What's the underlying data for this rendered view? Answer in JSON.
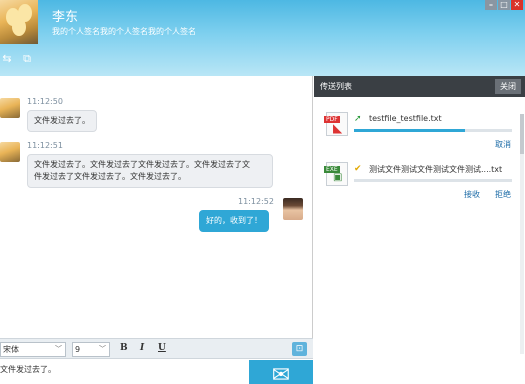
{
  "header": {
    "name": "李东",
    "signature": "我的个人签名我的个人签名我的个人签名",
    "window_buttons": {
      "minimize": "–",
      "maximize": "□",
      "close": "✕"
    },
    "tools": [
      {
        "icon": "transfer-file-icon",
        "glyph": "⇆"
      },
      {
        "icon": "remote-screen-icon",
        "glyph": "⧉"
      }
    ]
  },
  "chat": {
    "messages": [
      {
        "sender": "other",
        "time": "11:12:50",
        "text": "文件发过去了。"
      },
      {
        "sender": "other",
        "time": "11:12:51",
        "lines": [
          "文件发过去了。文件发过去了文件发过去了。文件发过去了文",
          "件发过去了文件发过去了。文件发过去了。"
        ]
      },
      {
        "sender": "self",
        "time": "11:12:52",
        "text": "好的，收到了！"
      }
    ]
  },
  "format_bar": {
    "font": "宋体",
    "size": "9",
    "bold": "B",
    "italic": "I",
    "underline": "U"
  },
  "input": {
    "value": "文件发过去了。"
  },
  "transfer_panel": {
    "title": "传送列表",
    "close_label": "关闭",
    "files": [
      {
        "name": "testfile_testfile.txt",
        "type": "PDF",
        "progress": 0.7,
        "actions": [
          "取消"
        ],
        "status_icon": "upload-arrow-icon"
      },
      {
        "name": "测试文件测试文件测试文件测试....txt",
        "type": "EXE",
        "progress": 0,
        "actions": [
          "接收",
          "拒绝"
        ],
        "status_icon": "check-icon"
      }
    ]
  },
  "colors": {
    "accent": "#2fa7d6",
    "header_top": "#4db8e3",
    "panel_header": "#3a3f44",
    "close_red": "#d9322b"
  }
}
